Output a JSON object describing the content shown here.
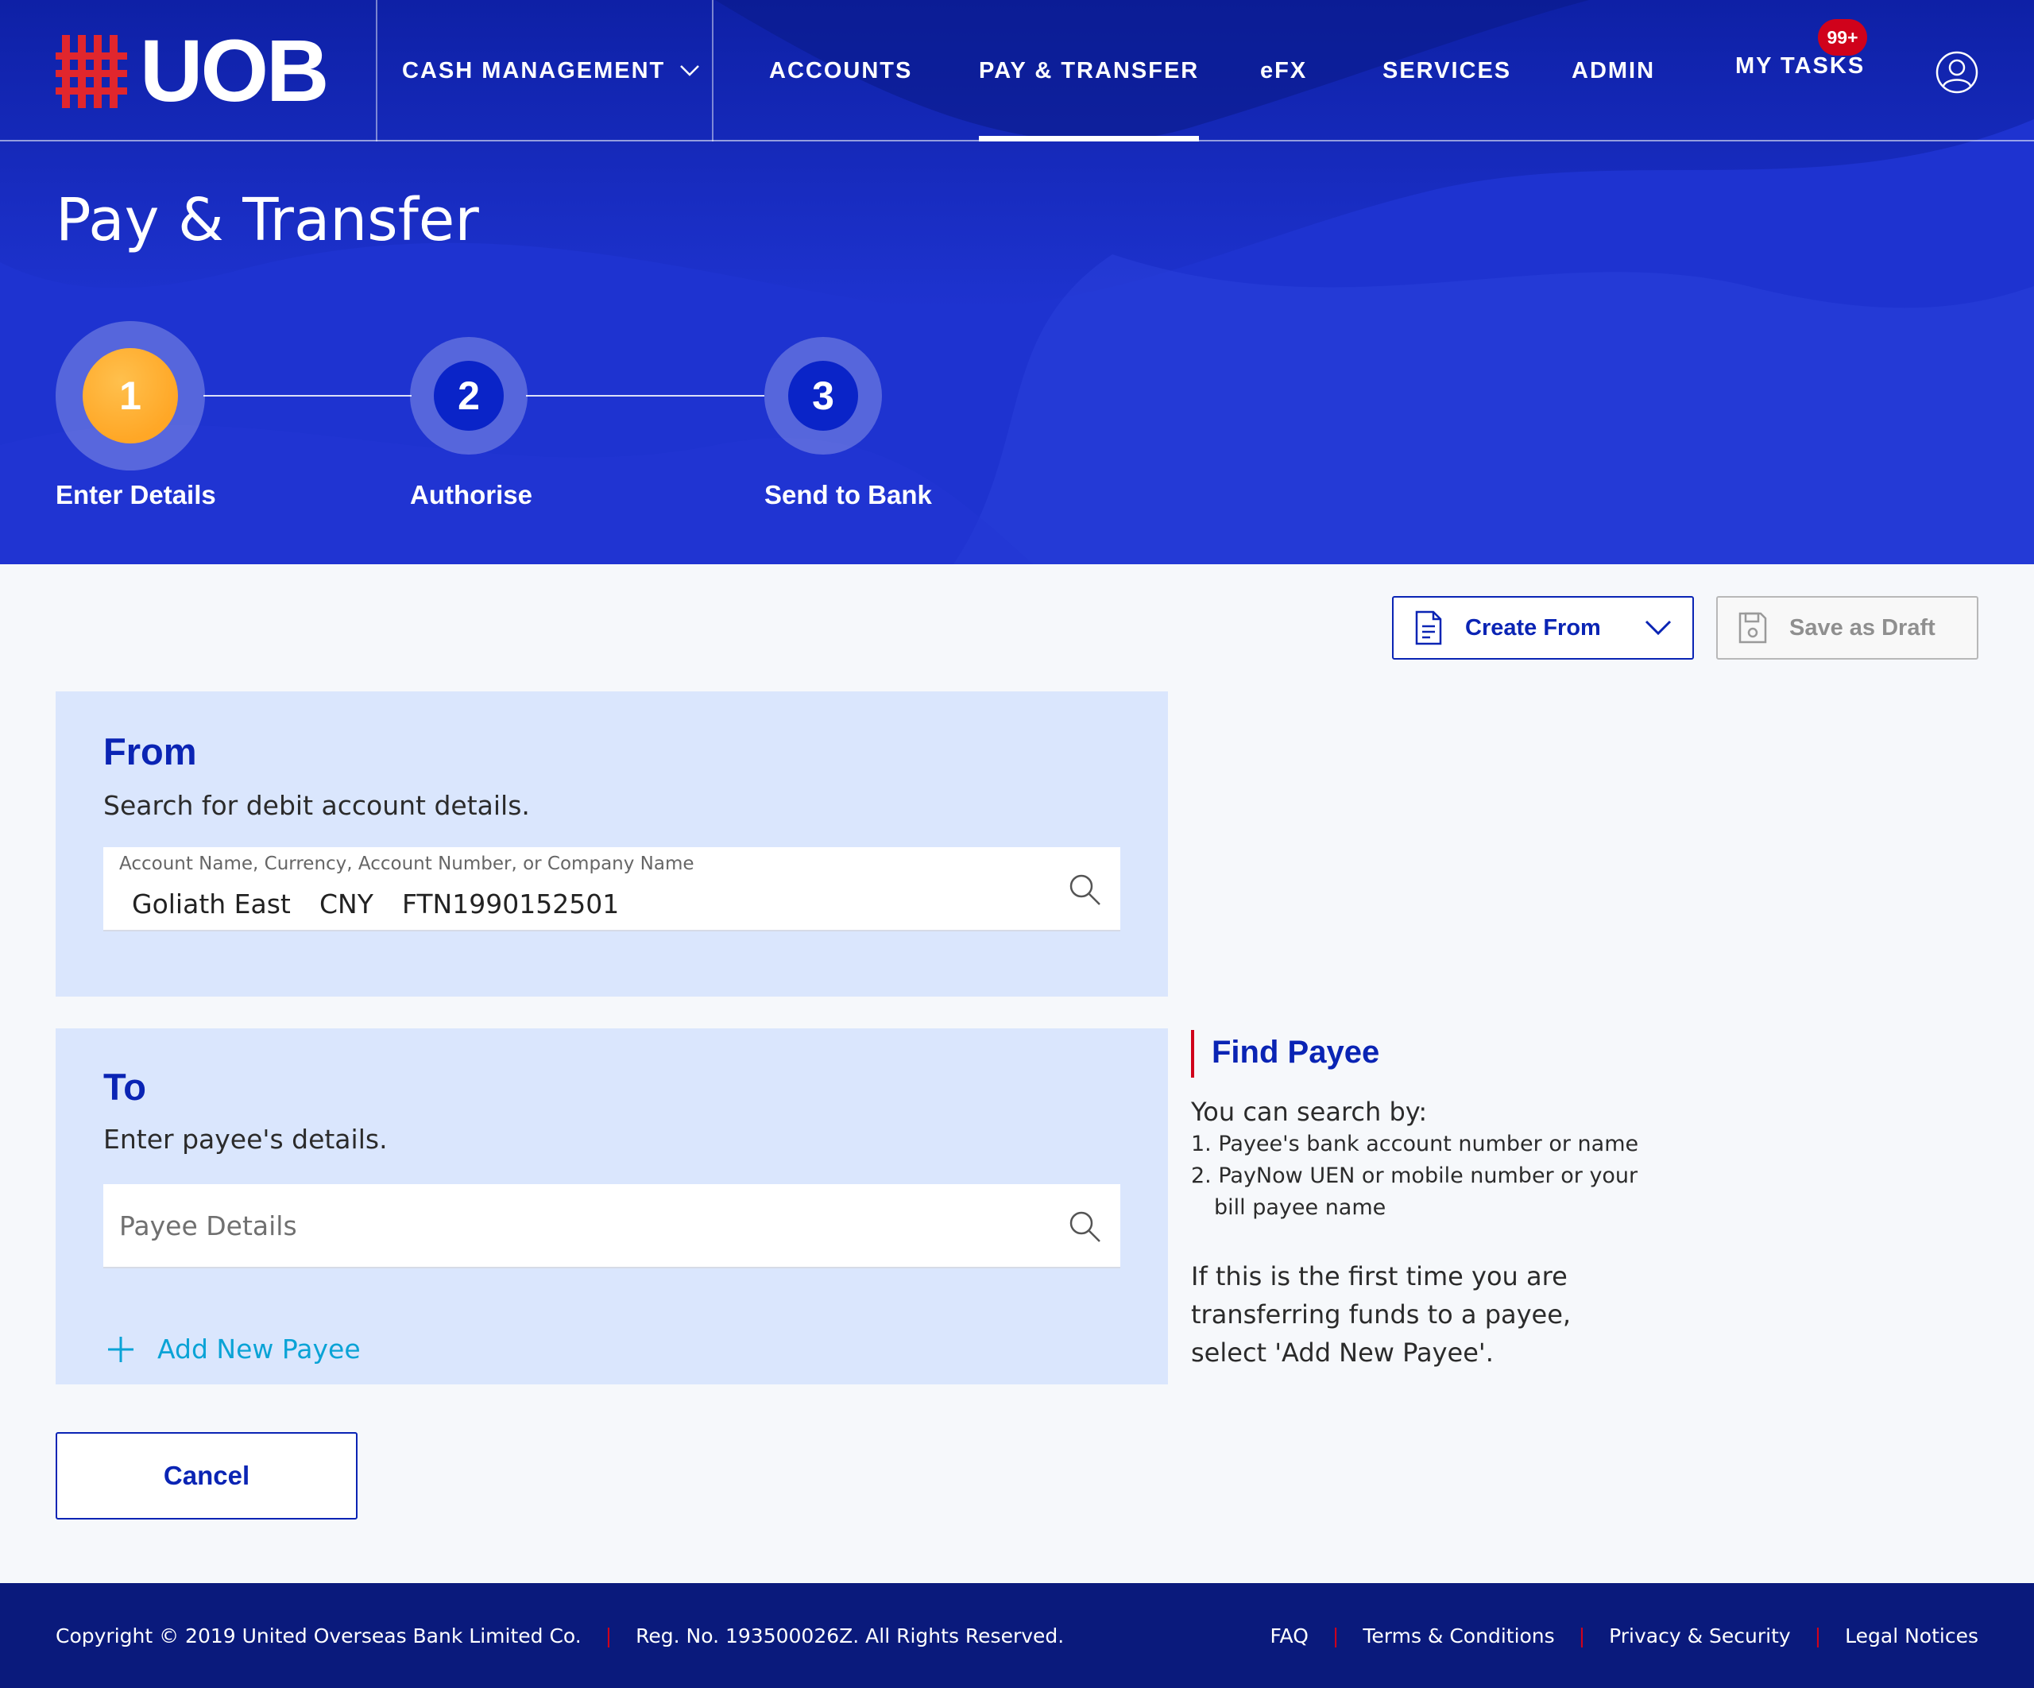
{
  "brand": {
    "logo_text": "UOB",
    "primary_color": "#1e33d0",
    "accent_red": "#d0021b",
    "step_active_color": "#ffa726"
  },
  "nav": {
    "items": [
      {
        "label": "CASH MANAGEMENT",
        "has_dropdown": true
      },
      {
        "label": "ACCOUNTS"
      },
      {
        "label": "PAY & TRANSFER",
        "active": true
      },
      {
        "label": "eFX"
      },
      {
        "label": "SERVICES"
      },
      {
        "label": "ADMIN"
      },
      {
        "label": "MY TASKS",
        "badge": "99+"
      }
    ],
    "user_icon": "user-circle-icon"
  },
  "page": {
    "title": "Pay & Transfer"
  },
  "stepper": {
    "steps": [
      {
        "number": "1",
        "label": "Enter Details",
        "state": "active"
      },
      {
        "number": "2",
        "label": "Authorise",
        "state": "pending"
      },
      {
        "number": "3",
        "label": "Send to Bank",
        "state": "pending"
      }
    ]
  },
  "actions": {
    "create_from": "Create From",
    "save_draft": "Save as Draft"
  },
  "from_panel": {
    "title": "From",
    "subtitle": "Search for debit account details.",
    "field_label": "Account Name, Currency, Account Number, or Company Name",
    "account_name": "Goliath East",
    "currency": "CNY",
    "account_number": "FTN1990152501"
  },
  "to_panel": {
    "title": "To",
    "subtitle": "Enter payee's details.",
    "placeholder": "Payee Details",
    "add_payee": "Add New Payee"
  },
  "find_payee": {
    "title": "Find Payee",
    "intro": "You can search by:",
    "item1": "1. Payee's bank account number or name",
    "item2_line1": "2. PayNow UEN or mobile number or your",
    "item2_line2": "bill payee name",
    "note": "If this is the first time you are transferring funds to a payee, select 'Add New Payee'."
  },
  "cancel": "Cancel",
  "footer": {
    "copyright": "Copyright © 2019 United Overseas Bank Limited Co.",
    "reg": "Reg. No. 193500026Z. All Rights Reserved.",
    "links": [
      "FAQ",
      "Terms & Conditions",
      "Privacy & Security",
      "Legal Notices"
    ]
  }
}
